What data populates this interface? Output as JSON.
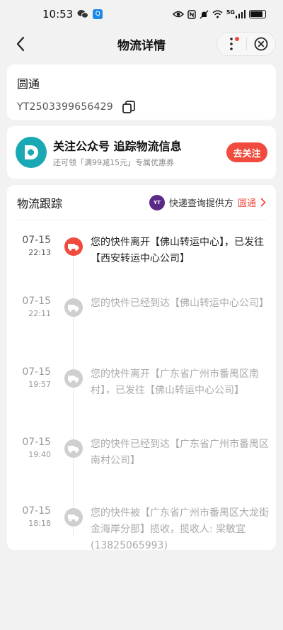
{
  "status_bar": {
    "time": "10:53",
    "network": "5G",
    "battery_percent": 85,
    "icons": [
      "wechat-icon",
      "qq-browser-icon",
      "eye-icon",
      "nfc-icon",
      "mute-icon",
      "wifi-icon",
      "signal-icon",
      "battery-icon"
    ]
  },
  "nav": {
    "title": "物流详情",
    "icons": [
      "back-arrow-icon",
      "more-dots-icon",
      "close-circle-icon"
    ],
    "has_notification_dot": true
  },
  "carrier": {
    "name": "圆通",
    "tracking_number": "YT2503399656429"
  },
  "follow": {
    "title": "关注公众号 追踪物流信息",
    "subtitle": "还可领「满99减15元」专属优惠券",
    "button_label": "去关注",
    "colors": {
      "logo": "#1aa8b5",
      "button": "#f04b3e"
    }
  },
  "tracking": {
    "title": "物流跟踪",
    "provider_label": "快递查询提供方",
    "provider_name": "圆通",
    "provider_logo_text": "YT",
    "events": [
      {
        "day": "07-15",
        "time": "22:13",
        "text": "您的快件离开【佛山转运中心】，已发往【西安转运中心公司】",
        "active": true
      },
      {
        "day": "07-15",
        "time": "22:11",
        "text": "您的快件已经到达【佛山转运中心公司】",
        "active": false
      },
      {
        "day": "07-15",
        "time": "19:57",
        "text": "您的快件离开【广东省广州市番禺区南村】，已发往【佛山转运中心公司】",
        "active": false
      },
      {
        "day": "07-15",
        "time": "19:40",
        "text": "您的快件已经到达【广东省广州市番禺区南村公司】",
        "active": false
      },
      {
        "day": "07-15",
        "time": "18:18",
        "text": "您的快件被【广东省广州市番禺区大龙街金海岸分部】揽收，揽收人: 梁敏宜 (13825065993)",
        "active": false
      }
    ]
  },
  "colors": {
    "accent": "#f04b3e",
    "background": "#f2f2f2"
  }
}
